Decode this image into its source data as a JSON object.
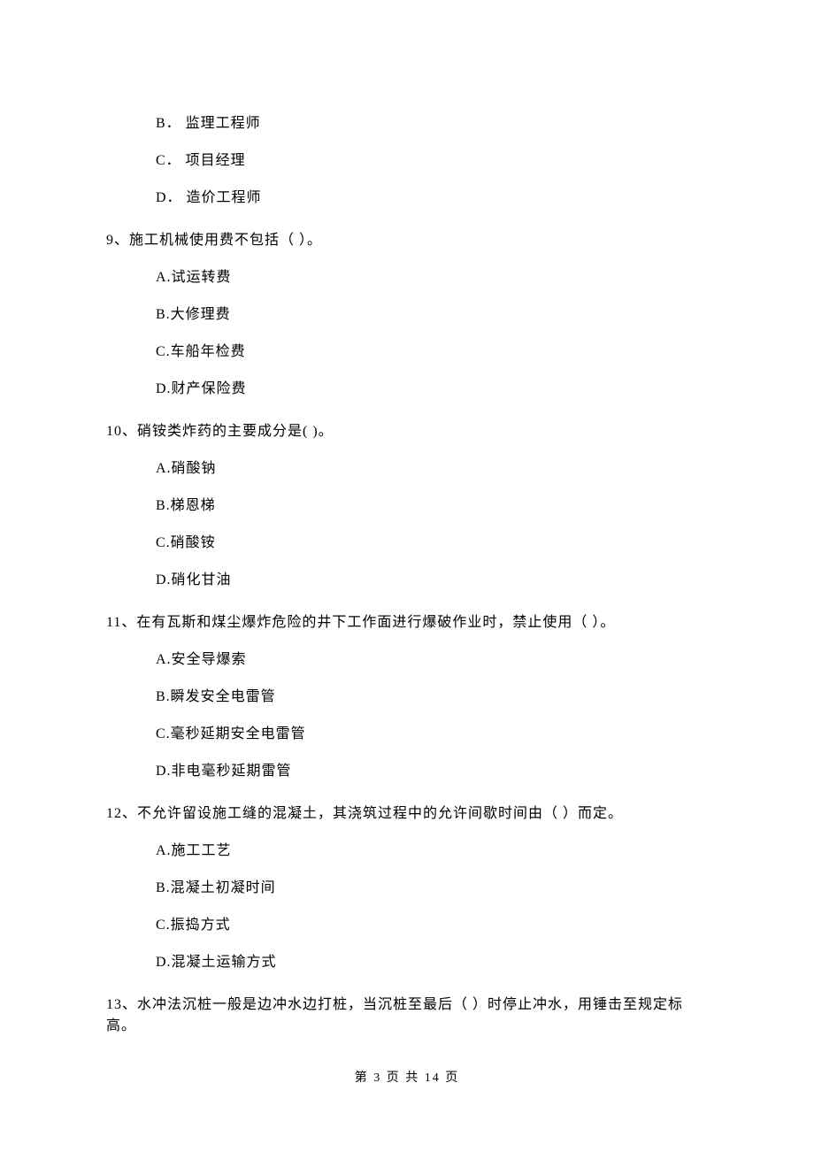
{
  "prev_options": {
    "b": "B．  监理工程师",
    "c": "C．  项目经理",
    "d": "D．  造价工程师"
  },
  "q9": {
    "stem": "9、施工机械使用费不包括（    ）。",
    "a": "A.试运转费",
    "b": "B.大修理费",
    "c": "C.车船年检费",
    "d": "D.财产保险费"
  },
  "q10": {
    "stem": "10、硝铵类炸药的主要成分是(    )。",
    "a": "A.硝酸钠",
    "b": "B.梯恩梯",
    "c": "C.硝酸铵",
    "d": "D.硝化甘油"
  },
  "q11": {
    "stem": "11、在有瓦斯和煤尘爆炸危险的井下工作面进行爆破作业时，禁止使用（    ）。",
    "a": "A.安全导爆索",
    "b": "B.瞬发安全电雷管",
    "c": "C.毫秒延期安全电雷管",
    "d": "D.非电毫秒延期雷管"
  },
  "q12": {
    "stem": "12、不允许留设施工缝的混凝土，其浇筑过程中的允许间歇时间由（    ）而定。",
    "a": "A.施工工艺",
    "b": "B.混凝土初凝时间",
    "c": "C.振捣方式",
    "d": "D.混凝土运输方式"
  },
  "q13": {
    "stem": "13、水冲法沉桩一般是边冲水边打桩，当沉桩至最后（    ）时停止冲水，用锤击至规定标高。"
  },
  "footer": "第 3 页 共 14 页"
}
